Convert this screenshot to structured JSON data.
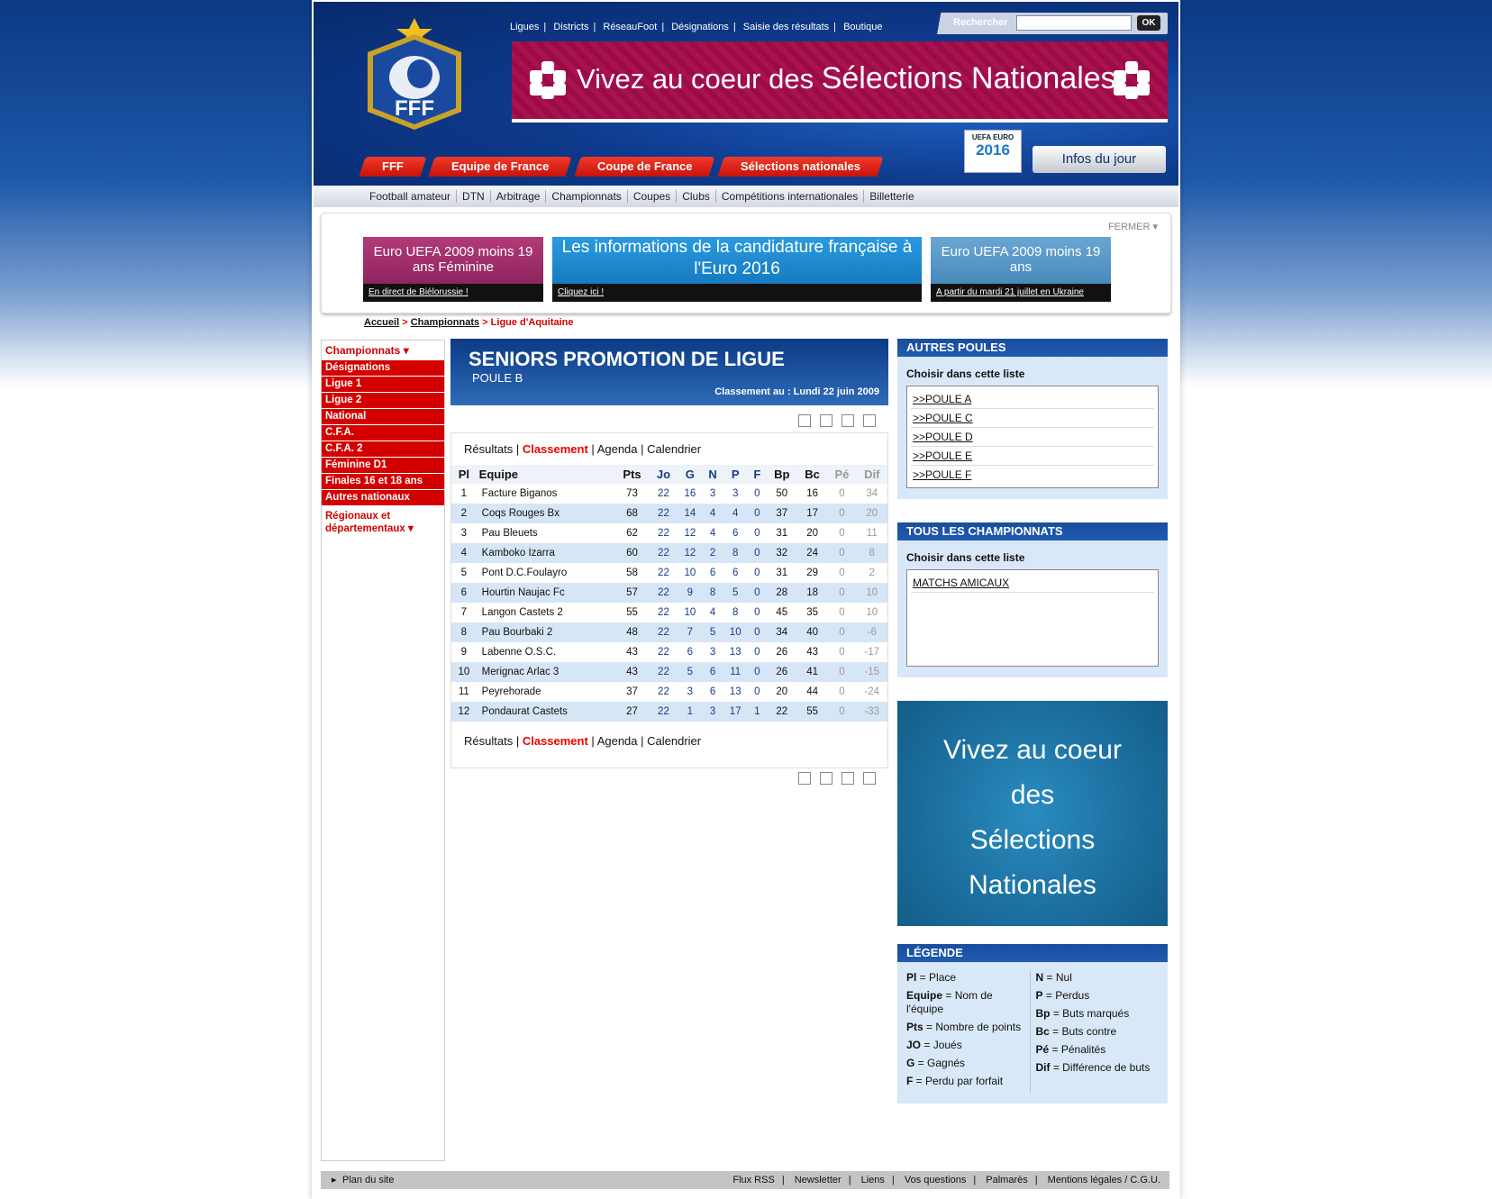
{
  "header": {
    "logo_text": "FFF",
    "top_links": [
      "Ligues",
      "Districts",
      "RéseauFoot",
      "Désignations",
      "Saisie des résultats",
      "Boutique"
    ],
    "search": {
      "label": "Rechercher",
      "value": "",
      "button": "OK"
    },
    "banner_text_1": "Vivez au coeur des ",
    "banner_text_2": "Sélections Nationales",
    "main_nav": [
      "FFF",
      "Equipe de France",
      "Coupe de France",
      "Sélections nationales"
    ],
    "euro_badge": {
      "line1": "UEFA EURO",
      "line2": "2016"
    },
    "infos_button": "Infos du jour"
  },
  "subnav": [
    "Football amateur",
    "DTN",
    "Arbitrage",
    "Championnats",
    "Coupes",
    "Clubs",
    "Compétitions internationales",
    "Billetterie"
  ],
  "promo": {
    "close_label": "FERMER",
    "boxes": [
      {
        "title": "Euro UEFA 2009 moins 19 ans Féminine",
        "link": "En direct de Biélorussie !",
        "color": "#b33a78"
      },
      {
        "title": "Les informations de la candidature française à l'Euro 2016",
        "link": "Cliquez ici !",
        "color": "#1d84c9"
      },
      {
        "title": "Euro UEFA 2009 moins 19 ans",
        "link": "A partir du mardi 21 juillet en Ukraine",
        "color": "#4b8fc0"
      }
    ]
  },
  "breadcrumb": {
    "home": "Accueil",
    "level1": "Championnats",
    "current": "Ligue d'Aquitaine",
    "sep": ">"
  },
  "sidebar": {
    "head": "Championnats",
    "items": [
      "Désignations",
      "Ligue 1",
      "Ligue 2",
      "National",
      "C.F.A.",
      "C.F.A. 2",
      "Féminine D1",
      "Finales 16 et 18 ans",
      "Autres nationaux"
    ],
    "regional": "Régionaux et départementaux"
  },
  "main": {
    "title": "SENIORS PROMOTION DE LIGUE",
    "subtitle": "POULE B",
    "date_label": "Classement au : Lundi 22 juin 2009",
    "tabs": [
      "Résultats",
      "Classement",
      "Agenda",
      "Calendrier"
    ],
    "columns": [
      "Pl",
      "Equipe",
      "Pts",
      "Jo",
      "G",
      "N",
      "P",
      "F",
      "Bp",
      "Bc",
      "Pé",
      "Dif"
    ],
    "rows": [
      [
        "1",
        "Facture Biganos",
        "73",
        "22",
        "16",
        "3",
        "3",
        "0",
        "50",
        "16",
        "0",
        "34"
      ],
      [
        "2",
        "Coqs Rouges Bx",
        "68",
        "22",
        "14",
        "4",
        "4",
        "0",
        "37",
        "17",
        "0",
        "20"
      ],
      [
        "3",
        "Pau Bleuets",
        "62",
        "22",
        "12",
        "4",
        "6",
        "0",
        "31",
        "20",
        "0",
        "11"
      ],
      [
        "4",
        "Kamboko Izarra",
        "60",
        "22",
        "12",
        "2",
        "8",
        "0",
        "32",
        "24",
        "0",
        "8"
      ],
      [
        "5",
        "Pont D.C.Foulayro",
        "58",
        "22",
        "10",
        "6",
        "6",
        "0",
        "31",
        "29",
        "0",
        "2"
      ],
      [
        "6",
        "Hourtin Naujac Fc",
        "57",
        "22",
        "9",
        "8",
        "5",
        "0",
        "28",
        "18",
        "0",
        "10"
      ],
      [
        "7",
        "Langon Castets 2",
        "55",
        "22",
        "10",
        "4",
        "8",
        "0",
        "45",
        "35",
        "0",
        "10"
      ],
      [
        "8",
        "Pau Bourbaki 2",
        "48",
        "22",
        "7",
        "5",
        "10",
        "0",
        "34",
        "40",
        "0",
        "-6"
      ],
      [
        "9",
        "Labenne O.S.C.",
        "43",
        "22",
        "6",
        "3",
        "13",
        "0",
        "26",
        "43",
        "0",
        "-17"
      ],
      [
        "10",
        "Merignac Arlac 3",
        "43",
        "22",
        "5",
        "6",
        "11",
        "0",
        "26",
        "41",
        "0",
        "-15"
      ],
      [
        "11",
        "Peyrehorade",
        "37",
        "22",
        "3",
        "6",
        "13",
        "0",
        "20",
        "44",
        "0",
        "-24"
      ],
      [
        "12",
        "Pondaurat Castets",
        "27",
        "22",
        "1",
        "3",
        "17",
        "1",
        "22",
        "55",
        "0",
        "-33"
      ]
    ]
  },
  "right": {
    "autres_poules": {
      "title": "AUTRES POULES",
      "sub": "Choisir dans cette liste",
      "items": [
        ">>POULE A",
        ">>POULE C",
        ">>POULE D",
        ">>POULE E",
        ">>POULE F"
      ]
    },
    "tous": {
      "title": "TOUS LES CHAMPIONNATS",
      "sub": "Choisir dans cette liste",
      "items": [
        "MATCHS AMICAUX"
      ]
    },
    "ad": [
      "Vivez au coeur",
      "des",
      "Sélections",
      "Nationales"
    ],
    "legend": {
      "title": "LÉGENDE",
      "left": [
        {
          "k": "Pl",
          "v": " = Place"
        },
        {
          "k": "Equipe",
          "v": " = Nom de l'équipe"
        },
        {
          "k": "Pts",
          "v": " = Nombre de points"
        },
        {
          "k": "JO",
          "v": " = Joués"
        },
        {
          "k": "G",
          "v": " = Gagnés"
        },
        {
          "k": "F",
          "v": " = Perdu par forfait"
        }
      ],
      "right": [
        {
          "k": "N",
          "v": " = Nul"
        },
        {
          "k": "P",
          "v": " = Perdus"
        },
        {
          "k": "Bp",
          "v": " = Buts marqués"
        },
        {
          "k": "Bc",
          "v": " = Buts contre"
        },
        {
          "k": "Pé",
          "v": " = Pénalités"
        },
        {
          "k": "Dif",
          "v": " = Différence de buts"
        }
      ]
    }
  },
  "footer": {
    "left": "Plan du site",
    "links": [
      "Flux RSS",
      "Newsletter",
      "Liens",
      "Vos questions",
      "Palmarès",
      "Mentions légales / C.G.U."
    ]
  }
}
